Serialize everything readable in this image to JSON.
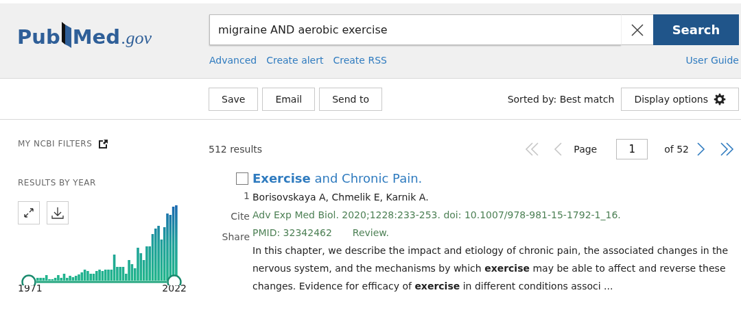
{
  "logo": {
    "pub": "Pub",
    "med": "Med",
    "domain": ".gov"
  },
  "search": {
    "value": "migraine AND aerobic exercise",
    "button": "Search"
  },
  "search_links": [
    "Advanced",
    "Create alert",
    "Create RSS"
  ],
  "user_guide": "User Guide",
  "actions": [
    "Save",
    "Email",
    "Send to"
  ],
  "sort": "Sorted by: Best match",
  "display_options": "Display options",
  "sidebar": {
    "filters_title": "MY NCBI FILTERS",
    "year_title": "RESULTS BY YEAR",
    "year_start": "1971",
    "year_end": "2022"
  },
  "results_count": "512 results",
  "pagination": {
    "before": [
      {
        "kind": "first",
        "disabled": true
      },
      {
        "kind": "prev",
        "disabled": true
      }
    ],
    "page_label": "Page",
    "page": "1",
    "of": "of 52",
    "after": [
      {
        "kind": "next",
        "disabled": false
      },
      {
        "kind": "last",
        "disabled": false
      }
    ]
  },
  "results": [
    {
      "checked": false,
      "number": "1",
      "title": "**Exercise** and Chronic Pain.",
      "authors": "Borisovskaya A, Chmelik E, Karnik A.",
      "citation": "Adv Exp Med Biol. 2020;1228:233-253. doi: 10.1007/978-981-15-1792-1_16.",
      "pmid": "PMID: 32342462",
      "type": "Review.",
      "snippet": "In this chapter, we describe the impact and etiology of chronic pain, the associated changes in the nervous system, and the mechanisms by which **exercise** may be able to affect and reverse these changes. Evidence for efficacy of **exercise** in different conditions associ ...",
      "actions": [
        "Cite",
        "Share"
      ]
    }
  ]
}
